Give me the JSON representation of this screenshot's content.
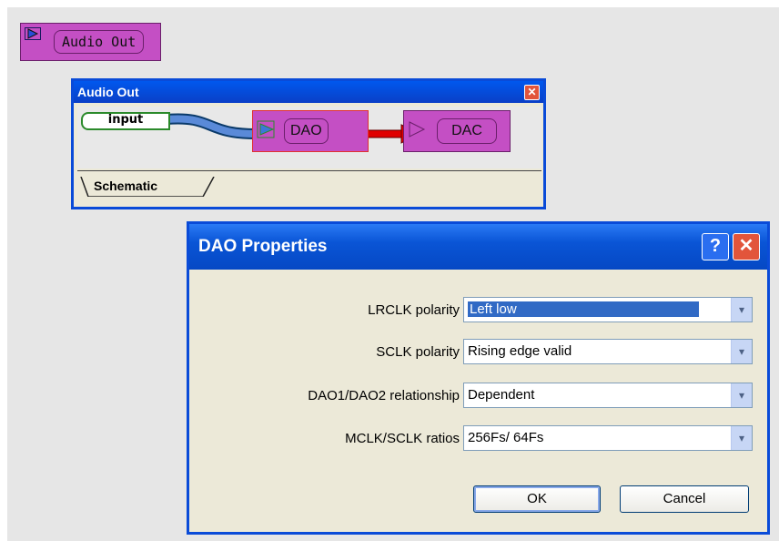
{
  "top_block": {
    "label": "Audio Out"
  },
  "sub_window": {
    "title": "Audio Out",
    "close_glyph": "✕",
    "input_pin": "input",
    "dao_label": "DAO",
    "dac_label": "DAC",
    "tab_label": "Schematic"
  },
  "dialog": {
    "title": "DAO Properties",
    "help_glyph": "?",
    "close_glyph": "✕",
    "fields": [
      {
        "label": "LRCLK polarity",
        "value": "Left low"
      },
      {
        "label": "SCLK polarity",
        "value": "Rising edge valid"
      },
      {
        "label": "DAO1/DAO2 relationship",
        "value": "Dependent"
      },
      {
        "label": "MCLK/SCLK ratios",
        "value": "256Fs/ 64Fs"
      }
    ],
    "ok_label": "OK",
    "cancel_label": "Cancel",
    "dropdown_glyph": "▾"
  },
  "colors": {
    "block_fill": "#c44fc4",
    "titlebar_blue": "#0a55d6",
    "selection_blue": "#316ac5",
    "wire_red": "#e00000"
  }
}
